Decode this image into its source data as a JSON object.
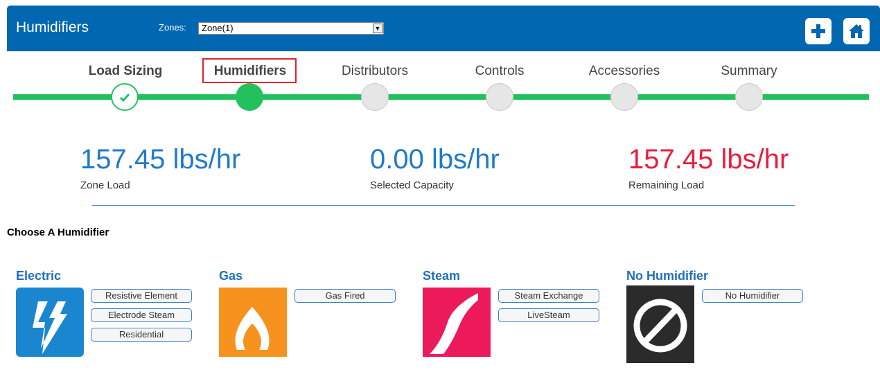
{
  "header": {
    "title": "Humidifiers",
    "zones_label": "Zones:",
    "zones_value": "Zone(1)",
    "add_icon": "plus-icon",
    "home_icon": "home-icon"
  },
  "steps": [
    {
      "label": "Load Sizing",
      "state": "done"
    },
    {
      "label": "Humidifiers",
      "state": "current"
    },
    {
      "label": "Distributors",
      "state": "pending"
    },
    {
      "label": "Controls",
      "state": "pending"
    },
    {
      "label": "Accessories",
      "state": "pending"
    },
    {
      "label": "Summary",
      "state": "pending"
    }
  ],
  "stats": {
    "zone_load": {
      "value": "157.45 lbs/hr",
      "label": "Zone Load"
    },
    "selected_capacity": {
      "value": "0.00 lbs/hr",
      "label": "Selected Capacity"
    },
    "remaining_load": {
      "value": "157.45 lbs/hr",
      "label": "Remaining Load"
    }
  },
  "section_title": "Choose A Humidifier",
  "categories": [
    {
      "title": "Electric",
      "color": "#1a86cf",
      "icon": "lightning-icon",
      "options": [
        "Resistive Element",
        "Electrode Steam",
        "Residential"
      ]
    },
    {
      "title": "Gas",
      "color": "#f7921e",
      "icon": "flame-icon",
      "options": [
        "Gas Fired"
      ]
    },
    {
      "title": "Steam",
      "color": "#ed1a5b",
      "icon": "steam-icon",
      "options": [
        "Steam Exchange",
        "LiveSteam"
      ]
    },
    {
      "title": "No Humidifier",
      "color": "#2b2b2b",
      "icon": "prohibited-icon",
      "options": [
        "No Humidifier"
      ]
    }
  ],
  "colors": {
    "header_bg": "#0167b1",
    "progress_green": "#22c15e",
    "value_blue": "#1f7ac9",
    "value_red": "#ec1c3c"
  }
}
